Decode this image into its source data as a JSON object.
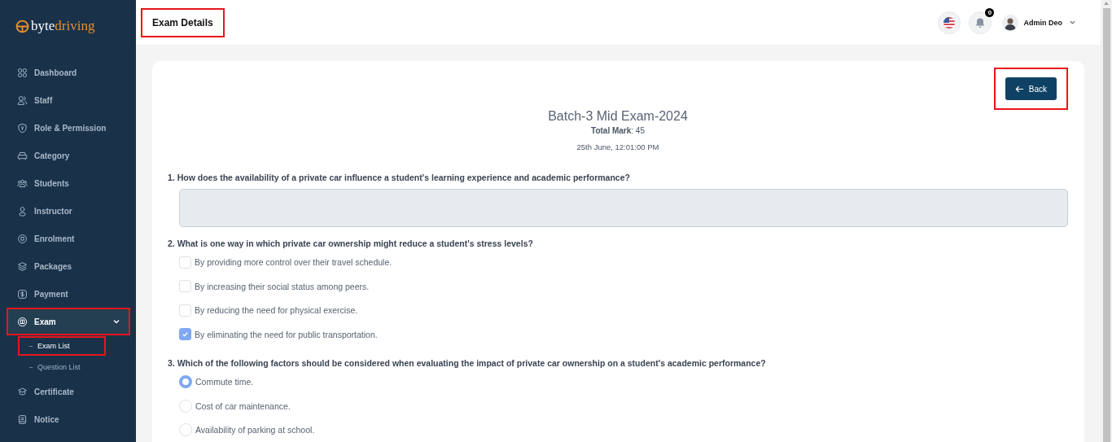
{
  "brand": {
    "part_1": "byte",
    "part_2": "driving"
  },
  "sidebar": {
    "items": [
      {
        "label": "Dashboard",
        "selected": false,
        "highlighted": false
      },
      {
        "label": "Staff",
        "selected": false,
        "highlighted": false
      },
      {
        "label": "Role & Permission",
        "selected": false,
        "highlighted": false
      },
      {
        "label": "Category",
        "selected": false,
        "highlighted": false
      },
      {
        "label": "Students",
        "selected": false,
        "highlighted": false
      },
      {
        "label": "Instructor",
        "selected": false,
        "highlighted": false
      },
      {
        "label": "Enrolment",
        "selected": false,
        "highlighted": false
      },
      {
        "label": "Packages",
        "selected": false,
        "highlighted": false
      },
      {
        "label": "Payment",
        "selected": false,
        "highlighted": false
      },
      {
        "label": "Exam",
        "selected": true,
        "highlighted": true,
        "expanded": true,
        "children": [
          {
            "label": "Exam List",
            "selected": true,
            "highlighted": true
          },
          {
            "label": "Question List",
            "selected": false,
            "highlighted": false
          }
        ]
      },
      {
        "label": "Certificate",
        "selected": false,
        "highlighted": false
      },
      {
        "label": "Notice",
        "selected": false,
        "highlighted": false
      }
    ]
  },
  "header": {
    "title": "Exam Details",
    "title_highlighted": true,
    "notification_count": "0",
    "user_name": "Admin Deo"
  },
  "exam": {
    "back_button": "Back",
    "back_highlighted": true,
    "title": "Batch-3 Mid Exam-2024",
    "total_mark": "**Total Mark**: 45",
    "date": "25th June, 12:01:00 PM",
    "questions": [
      {
        "kind": "text",
        "text": "1. How does the availability of a private car influence a student's learning experience and academic performance?"
      },
      {
        "kind": "checkbox",
        "text": "2. What is one way in which private car ownership might reduce a student's stress levels?",
        "options": [
          {
            "label": "By providing more control over their travel schedule.",
            "checked": false
          },
          {
            "label": "By increasing their social status among peers.",
            "checked": false
          },
          {
            "label": "By reducing the need for physical exercise.",
            "checked": false
          },
          {
            "label": "By eliminating the need for public transportation.",
            "checked": true
          }
        ]
      },
      {
        "kind": "radio",
        "text": "3. Which of the following factors should be considered when evaluating the impact of private car ownership on a student's academic performance?",
        "options": [
          {
            "label": "Commute time.",
            "checked": true
          },
          {
            "label": "Cost of car maintenance.",
            "checked": false
          },
          {
            "label": "Availability of parking at school.",
            "checked": false
          }
        ]
      }
    ]
  }
}
